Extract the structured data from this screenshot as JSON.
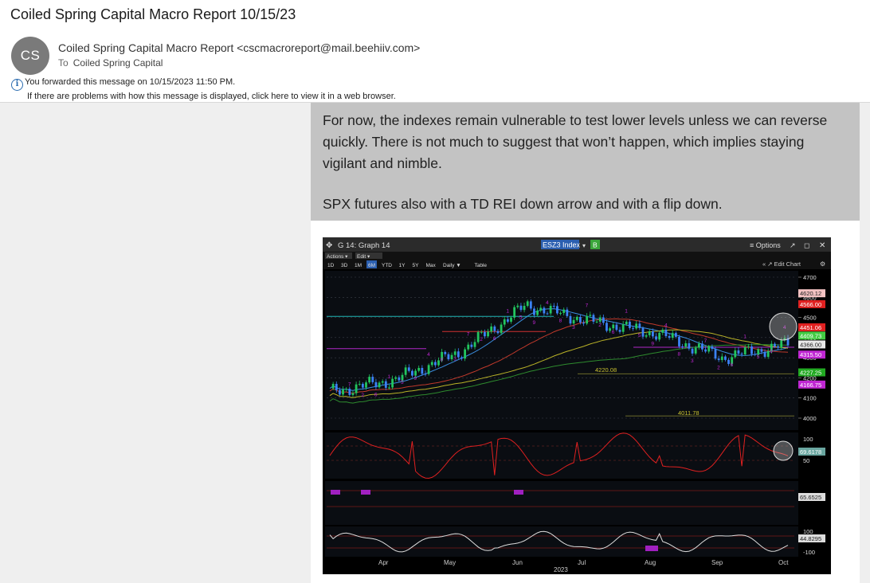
{
  "email": {
    "subject": "Coiled Spring Capital Macro Report 10/15/23",
    "avatar_initials": "CS",
    "sender": "Coiled Spring Capital Macro Report <cscmacroreport@mail.beehiiv.com>",
    "to_label": "To",
    "to_value": "Coiled Spring Capital",
    "forward_notice": "You forwarded this message on 10/15/2023 11:50 PM.",
    "display_notice": "If there are problems with how this message is displayed, click here to view it in a web browser."
  },
  "body": {
    "paragraph1": "For now, the indexes remain vulnerable to test lower levels unless we can reverse quickly. There is not much to suggest that won’t happen, which implies staying vigilant and nimble.",
    "paragraph2": "SPX futures also with a TD REI down arrow and with a flip down."
  },
  "terminal": {
    "graph_title": "G 14: Graph 14",
    "ticker": "ESZ3 Index",
    "options_label": "≡ Options",
    "menu": [
      "Actions ▾",
      "Edit ▾"
    ],
    "periods": [
      "1D",
      "3D",
      "1M",
      "6M",
      "YTD",
      "1Y",
      "5Y",
      "Max",
      "Daily ▼",
      "Table"
    ],
    "active_period": "6M",
    "edit_chart": "« ↗ Edit Chart",
    "price_ticks": [
      "4700",
      "4600",
      "4500",
      "4400",
      "4300",
      "4200",
      "4100",
      "4000"
    ],
    "price_labels": [
      {
        "text": "4620.12",
        "color": "#f4c2c2"
      },
      {
        "text": "4566.00",
        "color": "#e02020"
      },
      {
        "text": "4451.06",
        "color": "#e02020"
      },
      {
        "text": "4409.73",
        "color": "#44cc44"
      },
      {
        "text": "4366.00",
        "color": "#e8e8e8"
      },
      {
        "text": "4315.50",
        "color": "#c026d3"
      },
      {
        "text": "4227.25",
        "color": "#22aa22"
      },
      {
        "text": "4166.75",
        "color": "#c026d3"
      }
    ],
    "annotations": [
      "4220.08",
      "4011.78"
    ],
    "osc1_ticks": [
      "100",
      "50"
    ],
    "osc1_value": "69.6178",
    "osc2_value": "65.6525",
    "osc3_ticks": [
      "100",
      "-100"
    ],
    "osc3_value": "44.8295",
    "months": [
      "Apr",
      "May",
      "Jun",
      "Jul",
      "Aug",
      "Sep",
      "Oct"
    ],
    "year": "2023"
  },
  "chart_data": {
    "type": "candlestick",
    "title": "",
    "x": [
      "Apr",
      "May",
      "Jun",
      "Jul",
      "Aug",
      "Sep",
      "Oct"
    ],
    "close": [
      4130,
      4190,
      4330,
      4560,
      4480,
      4420,
      4300,
      4366
    ],
    "ylim": [
      3950,
      4750
    ],
    "year": "2023",
    "ticker": "ESZ3 Index"
  },
  "colors": {
    "chart_bg": "#000000",
    "up_candle": "#22c55e",
    "down_candle": "#3b82f6",
    "ma_red": "#c0392b",
    "ma_blue": "#3a8dde",
    "ma_yellow": "#b9b227",
    "ma_green": "#2e8b2e"
  }
}
